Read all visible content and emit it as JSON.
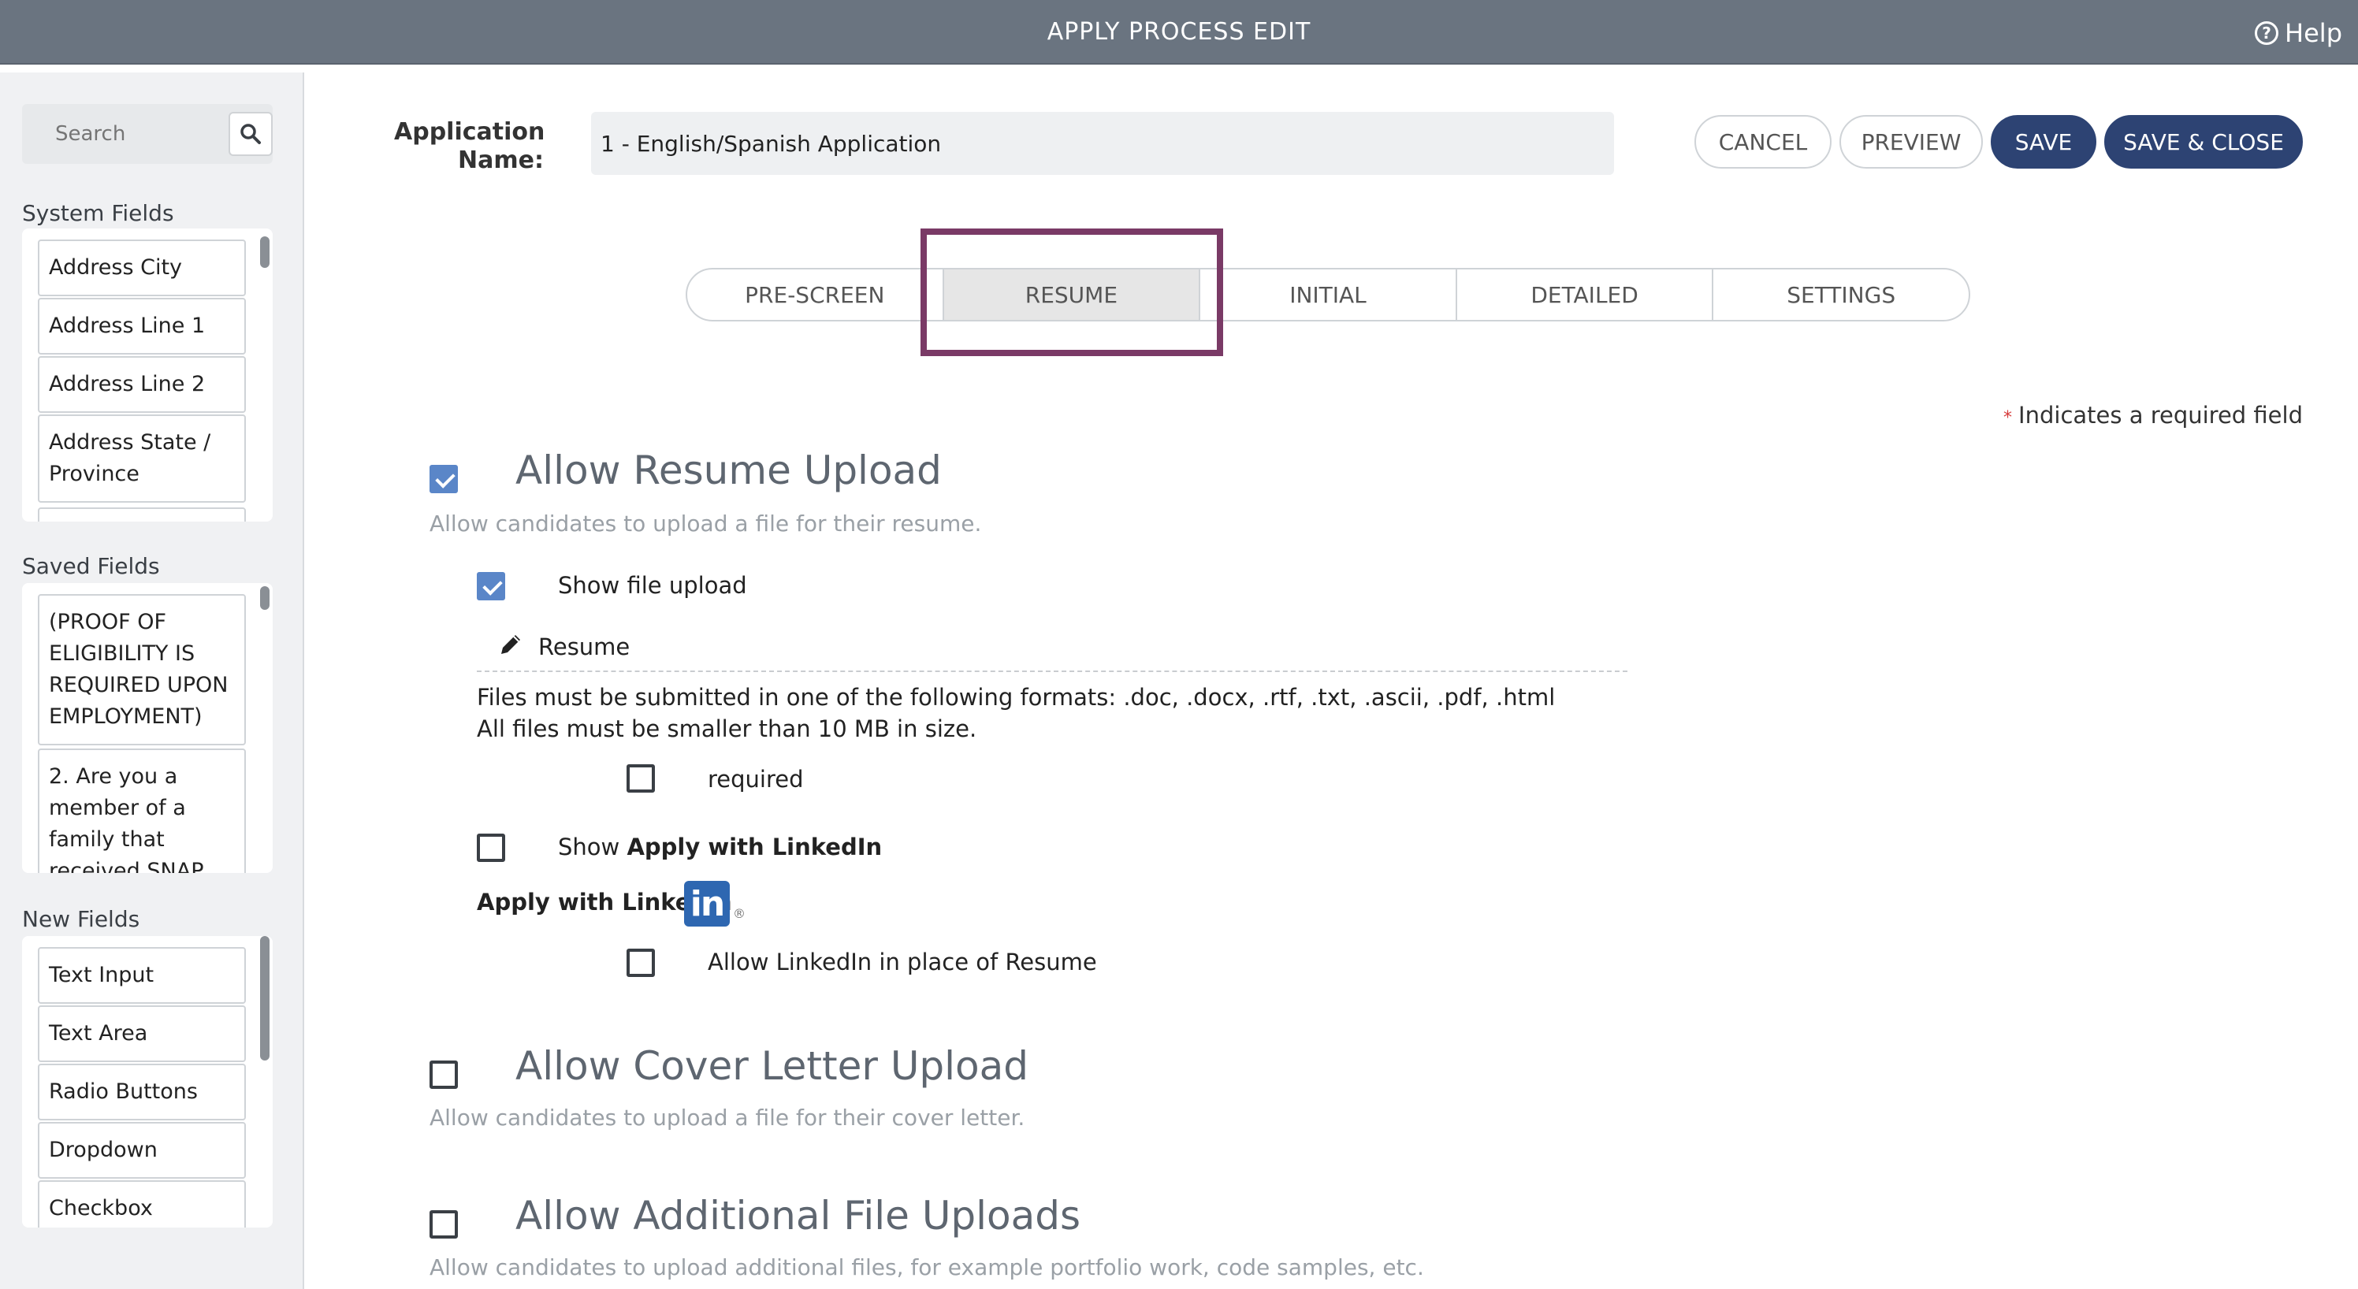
{
  "header": {
    "title": "APPLY PROCESS EDIT",
    "help_label": "Help"
  },
  "sidebar": {
    "search_placeholder": "Search",
    "system_fields_label": "System Fields",
    "system_fields": [
      "Address City",
      "Address Line 1",
      "Address Line 2",
      "Address State / Province"
    ],
    "saved_fields_label": "Saved Fields",
    "saved_fields": [
      "(PROOF OF ELIGIBILITY IS REQUIRED UPON EMPLOYMENT)",
      "2. Are you a member of a family that received SNAP"
    ],
    "new_fields_label": "New Fields",
    "new_fields": [
      "Text Input",
      "Text Area",
      "Radio Buttons",
      "Dropdown",
      "Checkbox"
    ]
  },
  "form": {
    "app_name_label": "Application Name:",
    "app_name_value": "1 - English/Spanish Application",
    "cancel_label": "CANCEL",
    "preview_label": "PREVIEW",
    "save_label": "SAVE",
    "save_close_label": "SAVE & CLOSE"
  },
  "tabs": [
    "PRE-SCREEN",
    "RESUME",
    "INITIAL",
    "DETAILED",
    "SETTINGS"
  ],
  "active_tab": "RESUME",
  "required_note": "Indicates a required field",
  "resume": {
    "title": "Allow Resume Upload",
    "desc": "Allow candidates to upload a file for their resume.",
    "checked": true,
    "show_file_upload_label": "Show file upload",
    "show_file_upload_checked": true,
    "field_label": "Resume",
    "formats_text": "Files must be submitted in one of the following formats: .doc, .docx, .rtf, .txt, .ascii, .pdf, .html",
    "size_text": "All files must be smaller than 10 MB in size.",
    "required_label": "required",
    "required_checked": false,
    "show_linkedin_prefix": "Show ",
    "show_linkedin_bold": "Apply with LinkedIn",
    "show_linkedin_checked": false,
    "apply_linkedin_text": "Apply with LinkedIn",
    "linkedin_logo": "in",
    "registered_mark": "®",
    "linkedin_replace_label": "Allow LinkedIn in place of Resume",
    "linkedin_replace_checked": false
  },
  "cover_letter": {
    "title": "Allow Cover Letter Upload",
    "desc": "Allow candidates to upload a file for their cover letter.",
    "checked": false
  },
  "additional": {
    "title": "Allow Additional File Uploads",
    "desc": "Allow candidates to upload additional files, for example portfolio work, code samples, etc.",
    "checked": false
  },
  "colors": {
    "topbar": "#6a7480",
    "primary": "#2d4373",
    "highlight": "#7a3a66",
    "checkbox": "#5a86c8"
  }
}
